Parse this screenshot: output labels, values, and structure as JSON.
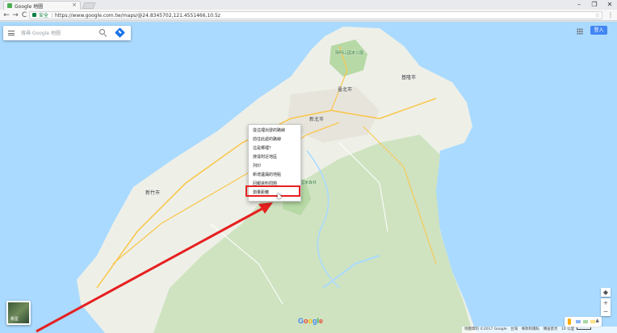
{
  "browser": {
    "tab_title": "Google 地圖",
    "tab_close": "×",
    "window_controls": {
      "minimize": "–",
      "maximize": "❐",
      "close": "✕"
    },
    "nav": {
      "back": "←",
      "forward": "→",
      "reload": "C"
    },
    "secure_label": "安全",
    "url": "https://www.google.com.tw/maps/@24.8345702,121.4551466,10.5z",
    "menu": "⋮"
  },
  "map": {
    "search_placeholder": "搜尋 Google 地圖",
    "signin_label": "登入",
    "labels": {
      "taipei": "臺北市",
      "new_taipei": "新北市",
      "keelung": "基隆市",
      "hsinchu": "新竹市",
      "yangmingshan": "陽明山國家公園",
      "park2": "國家森林"
    },
    "context_menu": {
      "items": [
        "從這裡出發的路線",
        "前往此處的路線",
        "這是哪裡？",
        "搜尋附近地區",
        "列印",
        "新增遺漏的地點",
        "回報資料問題",
        "測量距離"
      ],
      "highlighted_index": 7
    },
    "satellite_label": "衛星",
    "zoom_in": "+",
    "zoom_out": "−",
    "pegman_chevron": "▲",
    "google_logo": [
      "G",
      "o",
      "o",
      "g",
      "l",
      "e"
    ],
    "google_colors": [
      "#4285f4",
      "#ea4335",
      "#fbbc05",
      "#4285f4",
      "#34a853",
      "#ea4335"
    ],
    "attribution": {
      "data": "地圖資料 ©2017 Google",
      "region": "台灣",
      "terms": "條款和隱私",
      "feedback": "傳送意見",
      "scale": "10 公里"
    }
  },
  "colors": {
    "water": "#aadaff",
    "land": "#eef0e8",
    "forest": "#cfe3c1",
    "highway": "#f9c74f",
    "annotation_red": "#e62020",
    "accent_blue": "#4285f4"
  }
}
